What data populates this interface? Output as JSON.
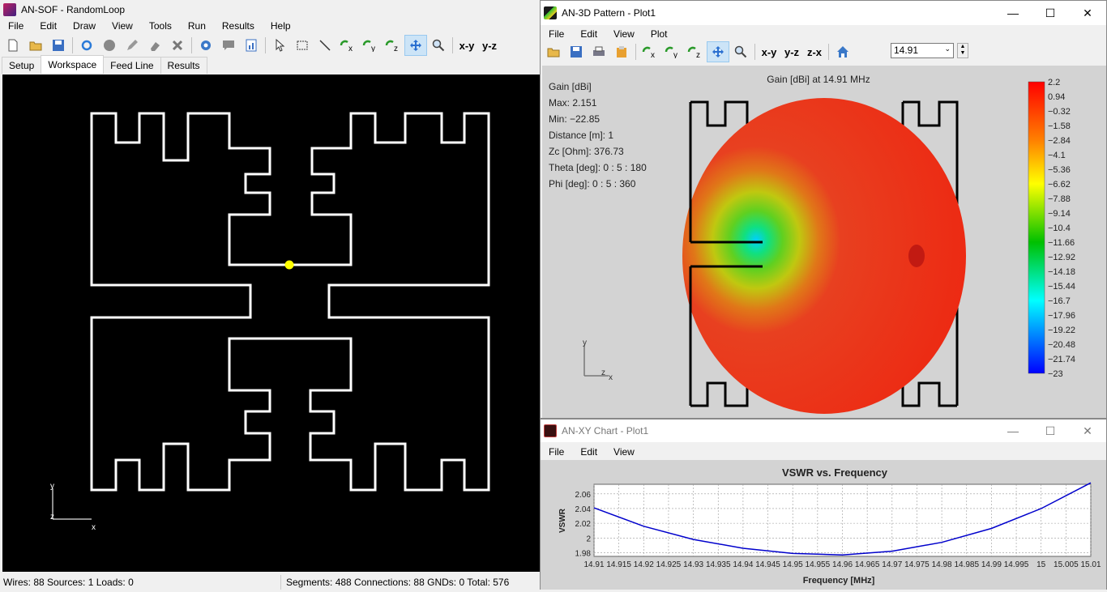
{
  "main": {
    "title": "AN-SOF - RandomLoop",
    "menu": [
      "File",
      "Edit",
      "Draw",
      "View",
      "Tools",
      "Run",
      "Results",
      "Help"
    ],
    "toolbar_xy": "x-y",
    "toolbar_yz": "y-z",
    "tabs": [
      "Setup",
      "Workspace",
      "Feed Line",
      "Results"
    ],
    "axis_y": "y",
    "axis_z": "z",
    "axis_x": "x",
    "status_left": "Wires: 88  Sources: 1  Loads: 0",
    "status_right": "Segments: 488  Connections: 88  GNDs: 0  Total: 576",
    "feed_color": "#ffff00"
  },
  "pattern": {
    "title": "AN-3D Pattern - Plot1",
    "menu": [
      "File",
      "Edit",
      "View",
      "Plot"
    ],
    "view_xy": "x-y",
    "view_yz": "y-z",
    "view_zx": "z-x",
    "freq_value": "14.91",
    "plot_title": "Gain [dBi] at 14.91 MHz",
    "info": [
      "Gain [dBi]",
      "Max: 2.151",
      "Min: −22.85",
      "Distance [m]: 1",
      "Zc [Ohm]: 376.73",
      "Theta [deg]: 0 : 5 : 180",
      "Phi [deg]: 0 : 5 : 360"
    ],
    "colorbar_labels": [
      "2.2",
      "0.94",
      "−0.32",
      "−1.58",
      "−2.84",
      "−4.1",
      "−5.36",
      "−6.62",
      "−7.88",
      "−9.14",
      "−10.4",
      "−11.66",
      "−12.92",
      "−14.18",
      "−15.44",
      "−16.7",
      "−17.96",
      "−19.22",
      "−20.48",
      "−21.74",
      "−23"
    ],
    "axis_y": "y",
    "axis_z": "z",
    "axis_x": "x"
  },
  "xychart": {
    "title": "AN-XY Chart - Plot1",
    "menu": [
      "File",
      "Edit",
      "View"
    ]
  },
  "chart_data": {
    "type": "line",
    "title": "VSWR vs. Frequency",
    "xlabel": "Frequency [MHz]",
    "ylabel": "VSWR",
    "x_ticks": [
      "14.91",
      "14.915",
      "14.92",
      "14.925",
      "14.93",
      "14.935",
      "14.94",
      "14.945",
      "14.95",
      "14.955",
      "14.96",
      "14.965",
      "14.97",
      "14.975",
      "14.98",
      "14.985",
      "14.99",
      "14.995",
      "15",
      "15.005",
      "15.01"
    ],
    "y_ticks": [
      "1.98",
      "2",
      "2.02",
      "2.04",
      "2.06"
    ],
    "xlim": [
      14.91,
      15.01
    ],
    "ylim": [
      1.975,
      2.073
    ],
    "grid": true,
    "series": [
      {
        "color": "#0000cc",
        "x": [
          14.91,
          14.92,
          14.93,
          14.94,
          14.95,
          14.96,
          14.97,
          14.98,
          14.99,
          15.0,
          15.01
        ],
        "y": [
          2.041,
          2.016,
          1.998,
          1.986,
          1.979,
          1.977,
          1.982,
          1.994,
          2.013,
          2.04,
          2.075
        ]
      }
    ]
  }
}
